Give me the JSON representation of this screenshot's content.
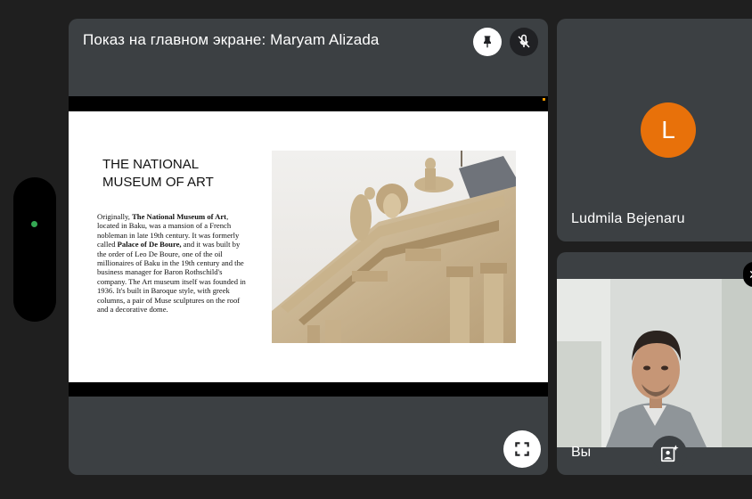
{
  "main": {
    "title": "Показ на главном экране: Maryam Alizada",
    "pin_icon": "pin-icon",
    "mic_icon": "mic-off-icon",
    "fullscreen_icon": "fullscreen-icon"
  },
  "slide": {
    "title_line1": "THE NATIONAL",
    "title_line2": "MUSEUM OF ART",
    "text": {
      "t1": "Originally, ",
      "b1": "The National Museum of Art",
      "t2": ", located in Baku, was a mansion of a French nobleman in late 19th century. It was formerly called ",
      "b2": "Palace of De Boure,",
      "t3": " and it was built by the order of Leo De Boure, one of the oil millionaires of Baku in the 19th century and the business manager for Baron Rothschild's company.  The Art museum itself was founded in 1936. It's built in Baroque style, with greek columns, a pair of Muse sculptures on the roof and a decorative dome."
    }
  },
  "participants": {
    "remote": {
      "initial": "L",
      "name": "Ludmila Bejenaru",
      "avatar_color": "#e8710a"
    },
    "self": {
      "label": "Вы",
      "effects_icon": "visual-effects-icon",
      "close_icon": "close-icon"
    }
  },
  "colors": {
    "background": "#1f1f1f",
    "tile": "#3c4043",
    "status_dot": "#34a853"
  }
}
